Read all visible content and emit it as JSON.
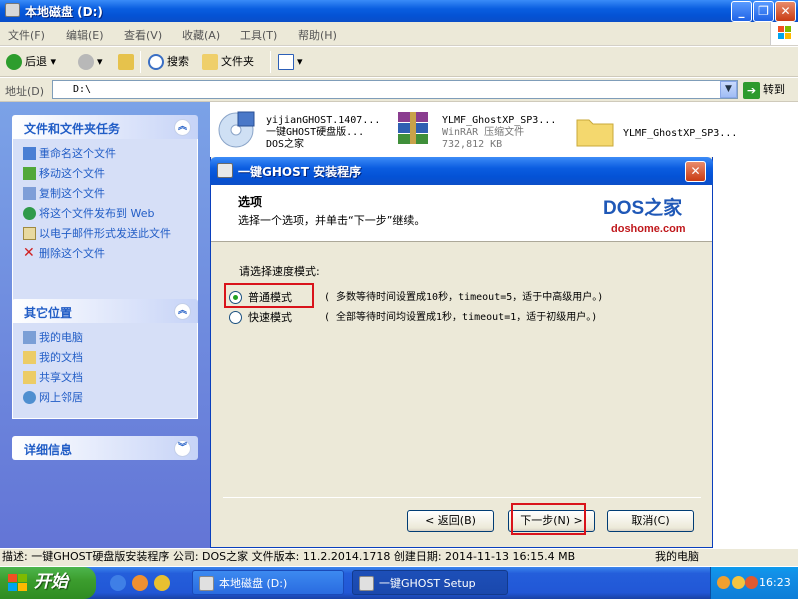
{
  "window": {
    "title": "本地磁盘 (D:)"
  },
  "menu": [
    "文件(F)",
    "编辑(E)",
    "查看(V)",
    "收藏(A)",
    "工具(T)",
    "帮助(H)"
  ],
  "toolbar": {
    "back": "后退",
    "search": "搜索",
    "folders": "文件夹"
  },
  "address": {
    "label": "地址(D)",
    "value": "D:\\",
    "go": "转到"
  },
  "tasks_panel": {
    "title": "文件和文件夹任务",
    "items": [
      "重命名这个文件",
      "移动这个文件",
      "复制这个文件",
      "将这个文件发布到 Web",
      "以电子邮件形式发送此文件",
      "删除这个文件"
    ]
  },
  "places_panel": {
    "title": "其它位置",
    "items": [
      "我的电脑",
      "我的文档",
      "共享文档",
      "网上邻居"
    ]
  },
  "details_panel": {
    "title": "详细信息"
  },
  "files": [
    {
      "name": "yijianGHOST.1407...",
      "line2": "一键GHOST硬盘版...",
      "line3": "DOS之家"
    },
    {
      "name": "YLMF_GhostXP_SP3...",
      "line2": "WinRAR 压缩文件",
      "line3": "732,812 KB"
    },
    {
      "name": "YLMF_GhostXP_SP3..."
    }
  ],
  "statusbar": {
    "text": "描述: 一键GHOST硬盘版安装程序 公司: DOS之家 文件版本: 11.2.2014.1718 创建日期: 2014-11-13 16:15.4 MB",
    "right": "我的电脑"
  },
  "taskbar": {
    "start": "开始",
    "tasks": [
      "本地磁盘 (D:)",
      "一键GHOST Setup"
    ],
    "clock": "16:23"
  },
  "dialog": {
    "title": "一键GHOST 安装程序",
    "header_title": "选项",
    "header_sub": "选择一个选项，并单击“下一步”继续。",
    "logo": "DOS之家",
    "logo_url": "doshome.com",
    "prompt": "请选择速度模式:",
    "options": [
      {
        "label": "普通模式",
        "desc": "( 多数等待时间设置成10秒，timeout=5，适于中高级用户。)",
        "selected": true
      },
      {
        "label": "快速模式",
        "desc": "( 全部等待时间均设置成1秒，timeout=1，适于初级用户。)",
        "selected": false
      }
    ],
    "buttons": {
      "back": "< 返回(B)",
      "next": "下一步(N) >",
      "cancel": "取消(C)"
    }
  },
  "colors": {
    "xp_blue": "#0453d5",
    "highlight_red": "#d9131b",
    "task_link": "#215dc6"
  }
}
